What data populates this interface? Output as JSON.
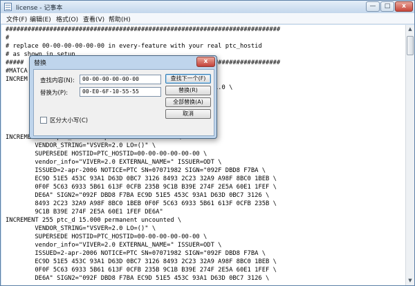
{
  "window": {
    "title": "license - 记事本",
    "controls": {
      "minimize": "—",
      "maximize": "□",
      "close": "x"
    }
  },
  "menubar": {
    "items": [
      "文件(F)",
      "编辑(E)",
      "格式(O)",
      "查看(V)",
      "帮助(H)"
    ]
  },
  "editor": {
    "lines": [
      "###########################################################################",
      "#",
      "# replace 00-00-00-00-00-00 in every-feature with your real ptc_hostid",
      "# as shown in setup",
      "#####                                  ####################################",
      "#MATCA",
      "INCREM                                 =(19)\" \\",
      "                                        ndor_info=\"VIVER=1.0 \\",
      "                                        TICE=\"PTC, \\",
      "                                        70ED A9DD EE4F \\",
      "                                        B 0584 A739 \\",
      "                                        F D9F 2933 \\",
      "        5F6B",
      "INCREMENT 254 ptc_d 15.000 permanent uncounted \\",
      "        VENDOR_STRING=\"VSVER=2.0 LO=()\" \\",
      "        SUPERSEDE HOSTID=PTC_HOSTID=00-00-00-00-00-00 \\",
      "        vendor_info=\"VIVER=2.0 EXTERNAL_NAME=\" ISSUER=ODT \\",
      "        ISSUED=2-apr-2006 NOTICE=PTC SN=07071982 SIGN=\"092F DBD8 F7BA \\",
      "        EC9D 51E5 453C 93A1 D63D 0BC7 3126 8493 2C23 32A9 A98F 8BC0 1BEB \\",
      "        0F0F 5C63 6933 5B61 613F 0CFB 235B 9C1B B39E 274F 2E5A 60E1 1FEF \\",
      "        DE6A\" SIGN2=\"092F DBD8 F7BA EC9D 51E5 453C 93A1 D63D 0BC7 3126 \\",
      "        8493 2C23 32A9 A98F 8BC0 1BEB 0F0F 5C63 6933 5B61 613F 0CFB 235B \\",
      "        9C1B B39E 274F 2E5A 60E1 1FEF DE6A\"",
      "INCREMENT 255 ptc_d 15.000 permanent uncounted \\",
      "        VENDOR_STRING=\"VSVER=2.0 LO=()\" \\",
      "        SUPERSEDE HOSTID=PTC_HOSTID=00-00-00-00-00-00 \\",
      "        vendor_info=\"VIVER=2.0 EXTERNAL_NAME=\" ISSUER=ODT \\",
      "        ISSUED=2-apr-2006 NOTICE=PTC SN=07071982 SIGN=\"092F DBD8 F7BA \\",
      "        EC9D 51E5 453C 93A1 D63D 0BC7 3126 8493 2C23 32A9 A98F 8BC0 1BEB \\",
      "        0F0F 5C63 6933 5B61 613F 0CFB 235B 9C1B B39E 274F 2E5A 60E1 1FEF \\",
      "        DE6A\" SIGN2=\"092F DBD8 F7BA EC9D 51E5 453C 93A1 D63D 0BC7 3126 \\"
    ]
  },
  "replace_dialog": {
    "title": "替换",
    "close": "x",
    "find_label": "查找内容(N):",
    "find_value": "00-00-00-00-00-00",
    "replace_label": "替换为(P):",
    "replace_value": "00-E0-6F-10-55-55",
    "match_case_label": "区分大小写(C)",
    "buttons": {
      "find_next": "查找下一个(F)",
      "replace": "替换(R)",
      "replace_all": "全部替换(A)",
      "cancel": "取消"
    }
  }
}
